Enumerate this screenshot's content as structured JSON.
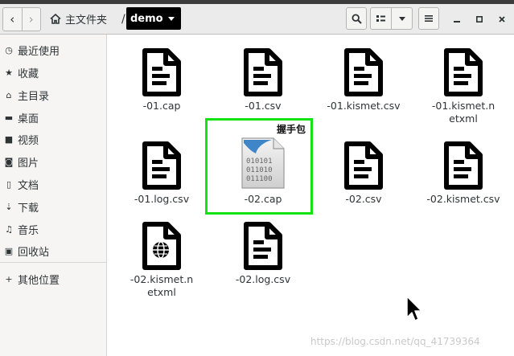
{
  "nav": {
    "back_icon": "chevron-left",
    "forward_icon": "chevron-right"
  },
  "breadcrumb": {
    "home_label": "主文件夹",
    "separator": "/",
    "current_label": "demo"
  },
  "toolbar": {
    "search_icon": "search-icon",
    "view_icon": "grid-view-icon",
    "sort_icon": "chevron-down-icon",
    "menu_icon": "hamburger-menu-icon"
  },
  "window": {
    "minimize_icon": "minimize-icon",
    "maximize_icon": "maximize-icon",
    "close_icon": "close-icon"
  },
  "sidebar": {
    "items": [
      {
        "label": "最近使用",
        "icon": "clock-icon",
        "glyph": "◷"
      },
      {
        "label": "收藏",
        "icon": "star-icon",
        "glyph": "★"
      },
      {
        "label": "主目录",
        "icon": "home-icon",
        "glyph": "⌂"
      },
      {
        "label": "桌面",
        "icon": "folder-icon",
        "glyph": "▬"
      },
      {
        "label": "视频",
        "icon": "video-icon",
        "glyph": "■"
      },
      {
        "label": "图片",
        "icon": "camera-icon",
        "glyph": "◙"
      },
      {
        "label": "文档",
        "icon": "document-icon",
        "glyph": "▯"
      },
      {
        "label": "下载",
        "icon": "download-icon",
        "glyph": "⇣"
      },
      {
        "label": "音乐",
        "icon": "music-icon",
        "glyph": "♫"
      },
      {
        "label": "回收站",
        "icon": "trash-icon",
        "glyph": "▣"
      }
    ],
    "other": {
      "label": "其他位置",
      "icon": "plus-icon",
      "glyph": "+"
    }
  },
  "files": [
    {
      "name": "-01.cap",
      "type": "text"
    },
    {
      "name": "-01.csv",
      "type": "text"
    },
    {
      "name": "-01.kismet.csv",
      "type": "text"
    },
    {
      "name": "-01.kismet.netxml",
      "type": "text"
    },
    {
      "name": "-01.log.csv",
      "type": "text"
    },
    {
      "name": "-02.cap",
      "type": "binary",
      "binary_lines": [
        "010101",
        "011010",
        "011100"
      ]
    },
    {
      "name": "-02.csv",
      "type": "text"
    },
    {
      "name": "-02.kismet.csv",
      "type": "text"
    },
    {
      "name": "-02.kismet.netxml",
      "type": "web"
    },
    {
      "name": "-02.log.csv",
      "type": "text"
    }
  ],
  "annotation": {
    "label": "握手包",
    "color": "#13e313"
  },
  "watermark": "https://blog.csdn.net/qq_41739364",
  "colors": {
    "accent_selected": "#000000",
    "highlight": "#13e313",
    "sidebar_bg": "#f6f5f4",
    "header_bg": "#ebebeb"
  }
}
